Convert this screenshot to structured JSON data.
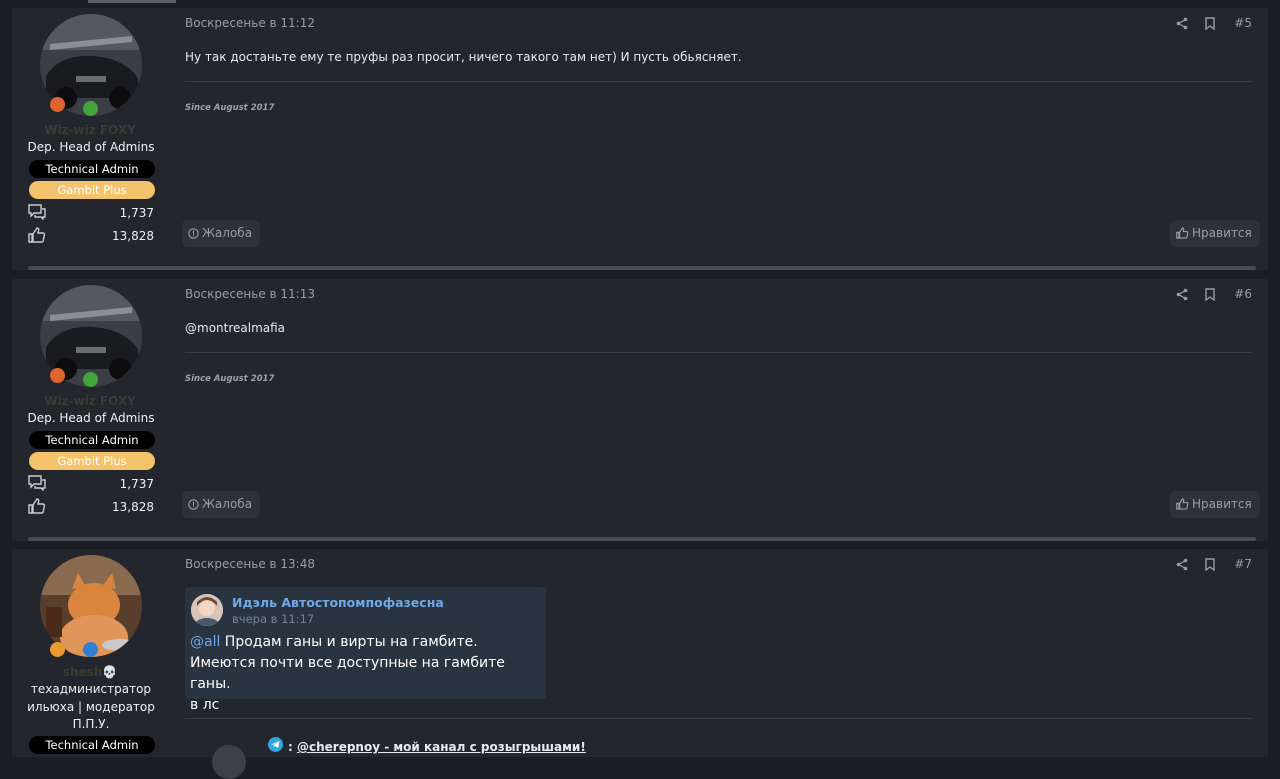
{
  "posts": [
    {
      "username": "Wiz-wiz FOXY",
      "user_title": "Dep. Head of Admins",
      "role_badge": "Technical Admin",
      "plan_badge": "Gambit Plus",
      "messages_count": "1,737",
      "reactions_count": "13,828",
      "date": "Воскресенье в 11:12",
      "post_number": "#5",
      "content": "Ну так достаньте ему те пруфы раз просит, ничего такого там нет) И пусть обьясняет.",
      "signature": "Since August 2017",
      "report_label": "Жалоба",
      "like_label": "Нравится"
    },
    {
      "username": "Wiz-wiz FOXY",
      "user_title": "Dep. Head of Admins",
      "role_badge": "Technical Admin",
      "plan_badge": "Gambit Plus",
      "messages_count": "1,737",
      "reactions_count": "13,828",
      "date": "Воскресенье в 11:13",
      "post_number": "#6",
      "content": "@montrealmafia",
      "signature": "Since August 2017",
      "report_label": "Жалоба",
      "like_label": "Нравится"
    },
    {
      "username": "shesh💀",
      "user_title_line1": "техадминистратор",
      "user_title_line2": "ильюха | модератор",
      "user_title_line3": "П.П.У.",
      "role_badge": "Technical Admin",
      "date": "Воскресенье в 13:48",
      "post_number": "#7",
      "quote": {
        "author": "Идэль Автостопомпофазесна",
        "time": "вчера в 11:17",
        "mention": "@all",
        "line1": " Продам ганы и вирты на гамбите.",
        "line2": "Имеются почти все доступные на гамбите ганы.",
        "line3": "в лс"
      },
      "telegram_prefix": ": ",
      "telegram_link": "@cherepnoy - мой канал с розыгрышами!"
    }
  ],
  "colors": {
    "background": "#1b1d23",
    "post_bg": "#23262d",
    "accent": "#6fa8e6",
    "gold": "#f3c46b"
  }
}
